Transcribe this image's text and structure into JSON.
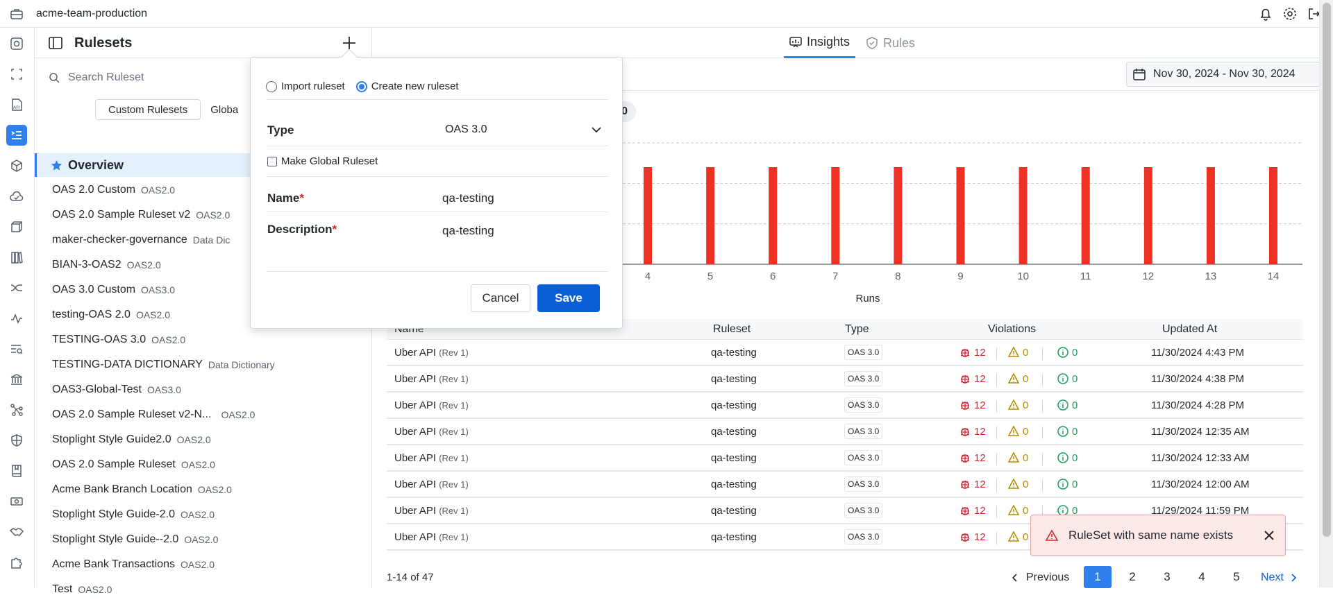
{
  "app": {
    "org_name": "acme-team-production"
  },
  "colors": {
    "accent": "#2f80ed",
    "bar": "#ee3124",
    "error": "#d1242f",
    "warning": "#b58900",
    "info": "#1a9c5b"
  },
  "panel": {
    "title": "Rulesets",
    "search_placeholder": "Search Ruleset",
    "segments": [
      "Custom Rulesets",
      "Globa"
    ],
    "overview_label": "Overview",
    "rulesets": [
      {
        "name": "OAS 2.0 Custom",
        "type": "OAS2.0"
      },
      {
        "name": "OAS 2.0 Sample Ruleset v2",
        "type": "OAS2.0"
      },
      {
        "name": "maker-checker-governance",
        "type": "Data Dic"
      },
      {
        "name": "BIAN-3-OAS2",
        "type": "OAS2.0"
      },
      {
        "name": "OAS 3.0 Custom",
        "type": "OAS3.0"
      },
      {
        "name": "testing-OAS 2.0",
        "type": "OAS2.0"
      },
      {
        "name": "TESTING-OAS 3.0",
        "type": "OAS2.0"
      },
      {
        "name": "TESTING-DATA DICTIONARY",
        "type": "Data Dictionary"
      },
      {
        "name": "OAS3-Global-Test",
        "type": "OAS3.0"
      },
      {
        "name": "OAS 2.0 Sample Ruleset v2-N...",
        "type": "OAS2.0"
      },
      {
        "name": "Stoplight Style Guide2.0",
        "type": "OAS2.0"
      },
      {
        "name": "OAS 2.0 Sample Ruleset",
        "type": "OAS2.0"
      },
      {
        "name": "Acme Bank Branch Location",
        "type": "OAS2.0"
      },
      {
        "name": "Stoplight Style Guide-2.0",
        "type": "OAS2.0"
      },
      {
        "name": "Stoplight Style Guide--2.0",
        "type": "OAS2.0"
      },
      {
        "name": "Acme Bank Transactions",
        "type": "OAS2.0"
      },
      {
        "name": "Test",
        "type": "OAS2.0"
      }
    ]
  },
  "tabs": [
    {
      "label": "Insights"
    },
    {
      "label": "Rules"
    }
  ],
  "date_range": "Nov 30, 2024 - Nov 30, 2024",
  "pill_fragment": "0",
  "chart_data": {
    "type": "bar",
    "xlabel": "Runs",
    "categories": [
      "4",
      "5",
      "6",
      "7",
      "8",
      "9",
      "10",
      "11",
      "12",
      "13",
      "14"
    ],
    "values": [
      12,
      12,
      12,
      12,
      12,
      12,
      12,
      12,
      12,
      12,
      12
    ],
    "ylim": [
      0,
      15
    ],
    "grid": true
  },
  "table": {
    "headers": [
      "Name",
      "Ruleset",
      "Type",
      "Violations",
      "Updated At"
    ],
    "rows": [
      {
        "name": "Uber API",
        "rev": "(Rev 1)",
        "ruleset": "qa-testing",
        "type": "OAS 3.0",
        "errors": "12",
        "warnings": "0",
        "infos": "0",
        "updated": "11/30/2024 4:43 PM"
      },
      {
        "name": "Uber API",
        "rev": "(Rev 1)",
        "ruleset": "qa-testing",
        "type": "OAS 3.0",
        "errors": "12",
        "warnings": "0",
        "infos": "0",
        "updated": "11/30/2024 4:38 PM"
      },
      {
        "name": "Uber API",
        "rev": "(Rev 1)",
        "ruleset": "qa-testing",
        "type": "OAS 3.0",
        "errors": "12",
        "warnings": "0",
        "infos": "0",
        "updated": "11/30/2024 4:28 PM"
      },
      {
        "name": "Uber API",
        "rev": "(Rev 1)",
        "ruleset": "qa-testing",
        "type": "OAS 3.0",
        "errors": "12",
        "warnings": "0",
        "infos": "0",
        "updated": "11/30/2024 12:35 AM"
      },
      {
        "name": "Uber API",
        "rev": "(Rev 1)",
        "ruleset": "qa-testing",
        "type": "OAS 3.0",
        "errors": "12",
        "warnings": "0",
        "infos": "0",
        "updated": "11/30/2024 12:33 AM"
      },
      {
        "name": "Uber API",
        "rev": "(Rev 1)",
        "ruleset": "qa-testing",
        "type": "OAS 3.0",
        "errors": "12",
        "warnings": "0",
        "infos": "0",
        "updated": "11/30/2024 12:00 AM"
      },
      {
        "name": "Uber API",
        "rev": "(Rev 1)",
        "ruleset": "qa-testing",
        "type": "OAS 3.0",
        "errors": "12",
        "warnings": "0",
        "infos": "0",
        "updated": "11/29/2024 11:59 PM"
      },
      {
        "name": "Uber API",
        "rev": "(Rev 1)",
        "ruleset": "qa-testing",
        "type": "OAS 3.0",
        "errors": "12",
        "warnings": "0",
        "infos": "",
        "updated": ""
      }
    ]
  },
  "pagination": {
    "count_text": "1-14 of 47",
    "previous": "Previous",
    "next": "Next",
    "pages": [
      "1",
      "2",
      "3",
      "4",
      "5"
    ],
    "current": "1"
  },
  "modal": {
    "import_label": "Import ruleset",
    "create_label": "Create new ruleset",
    "type_label": "Type",
    "type_value": "OAS 3.0",
    "global_label": "Make Global Ruleset",
    "name_label": "Name",
    "name_value": "qa-testing",
    "description_label": "Description",
    "description_value": "qa-testing",
    "required_mark": "*",
    "cancel": "Cancel",
    "save": "Save"
  },
  "toast": {
    "message": "RuleSet with same name exists"
  }
}
